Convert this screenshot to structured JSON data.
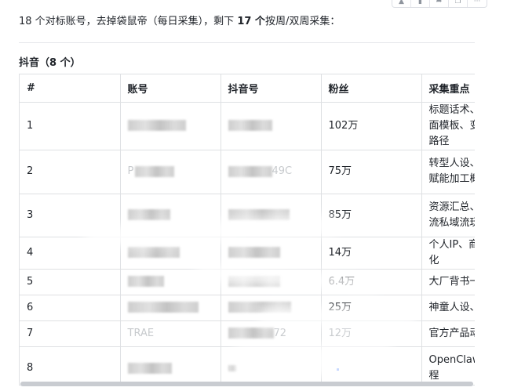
{
  "toolbar": {
    "icons": [
      "like-icon",
      "comment-icon",
      "share-icon",
      "copy-icon",
      "more-icon"
    ],
    "more_label": "···"
  },
  "intro": {
    "part1": "18 个对标账号，去掉袋鼠帝（每日采集），剩下 ",
    "count": "17 个",
    "part2": "按周/双周采集："
  },
  "section": {
    "title": "抖音（8 个）"
  },
  "table": {
    "headers": [
      "#",
      "账号",
      "抖音号",
      "粉丝",
      "采集重点"
    ],
    "rows": [
      {
        "index": "1",
        "account": "",
        "douyin_id": "",
        "fans": "102万",
        "focus": "标题话术、封面模板、变现路径"
      },
      {
        "index": "2",
        "account": "P",
        "douyin_id": "",
        "id_tail": "49C",
        "fans": "75万",
        "focus": "转型人设、AI赋能加工概念"
      },
      {
        "index": "3",
        "account": "",
        "douyin_id": "",
        "fans": "85万",
        "focus": "资源汇总、引流私域流玩法"
      },
      {
        "index": "4",
        "account": "",
        "douyin_id": "",
        "fans": "14万",
        "focus": "个人IP、商业化"
      },
      {
        "index": "5",
        "account": "",
        "douyin_id": "",
        "fans": "6.4万",
        "focus": "大厂背书一"
      },
      {
        "index": "6",
        "account": "",
        "douyin_id": "",
        "fans": "25万",
        "focus": "神童人设、"
      },
      {
        "index": "7",
        "account": "TRAE",
        "douyin_id": "",
        "id_tail": "72",
        "fans": "12万",
        "focus": "官方产品动"
      },
      {
        "index": "8",
        "account": "",
        "douyin_id": "",
        "fans": "",
        "focus": "OpenClaw 教程"
      }
    ]
  }
}
